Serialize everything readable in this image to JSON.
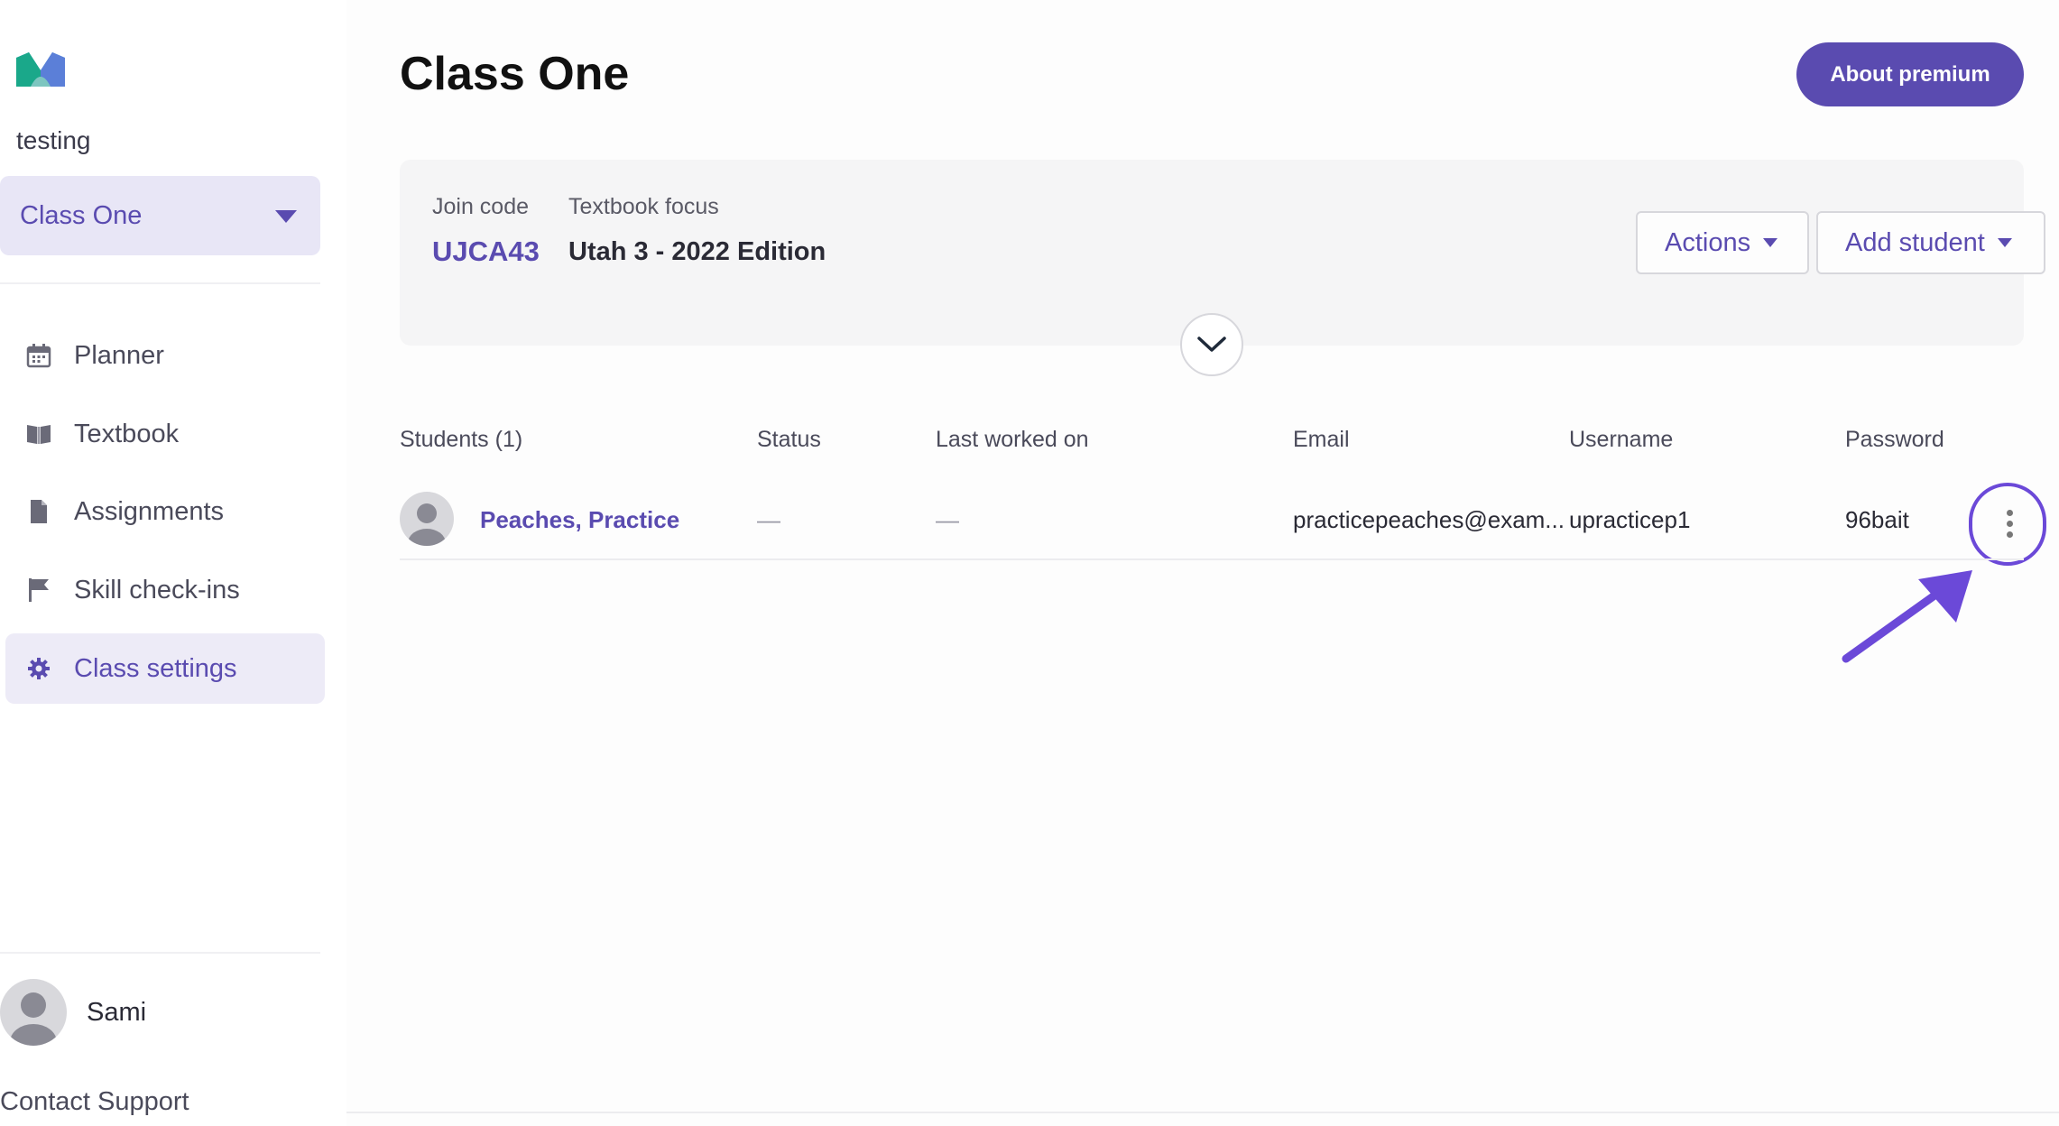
{
  "sidebar": {
    "org_name": "testing",
    "class_selector": {
      "label": "Class One"
    },
    "nav": [
      {
        "label": "Planner",
        "icon": "calendar-icon"
      },
      {
        "label": "Textbook",
        "icon": "book-icon"
      },
      {
        "label": "Assignments",
        "icon": "document-icon"
      },
      {
        "label": "Skill check-ins",
        "icon": "flag-icon"
      },
      {
        "label": "Class settings",
        "icon": "gear-icon",
        "active": true
      }
    ],
    "user": {
      "name": "Sami"
    },
    "contact_support": "Contact Support"
  },
  "header": {
    "title": "Class One",
    "premium_button": "About premium"
  },
  "class_info": {
    "join_code_label": "Join code",
    "join_code": "UJCA43",
    "textbook_label": "Textbook focus",
    "textbook": "Utah 3 - 2022 Edition",
    "actions_button": "Actions",
    "add_student_button": "Add student"
  },
  "table": {
    "headers": {
      "students": "Students (1)",
      "status": "Status",
      "last_worked": "Last worked on",
      "email": "Email",
      "username": "Username",
      "password": "Password"
    },
    "rows": [
      {
        "name": "Peaches, Practice",
        "status": "—",
        "last_worked": "—",
        "email": "practicepeaches@exam...",
        "username": "upracticep1",
        "password": "96bait"
      }
    ]
  },
  "colors": {
    "accent": "#5a4bb0",
    "highlight": "#6b49d8"
  }
}
